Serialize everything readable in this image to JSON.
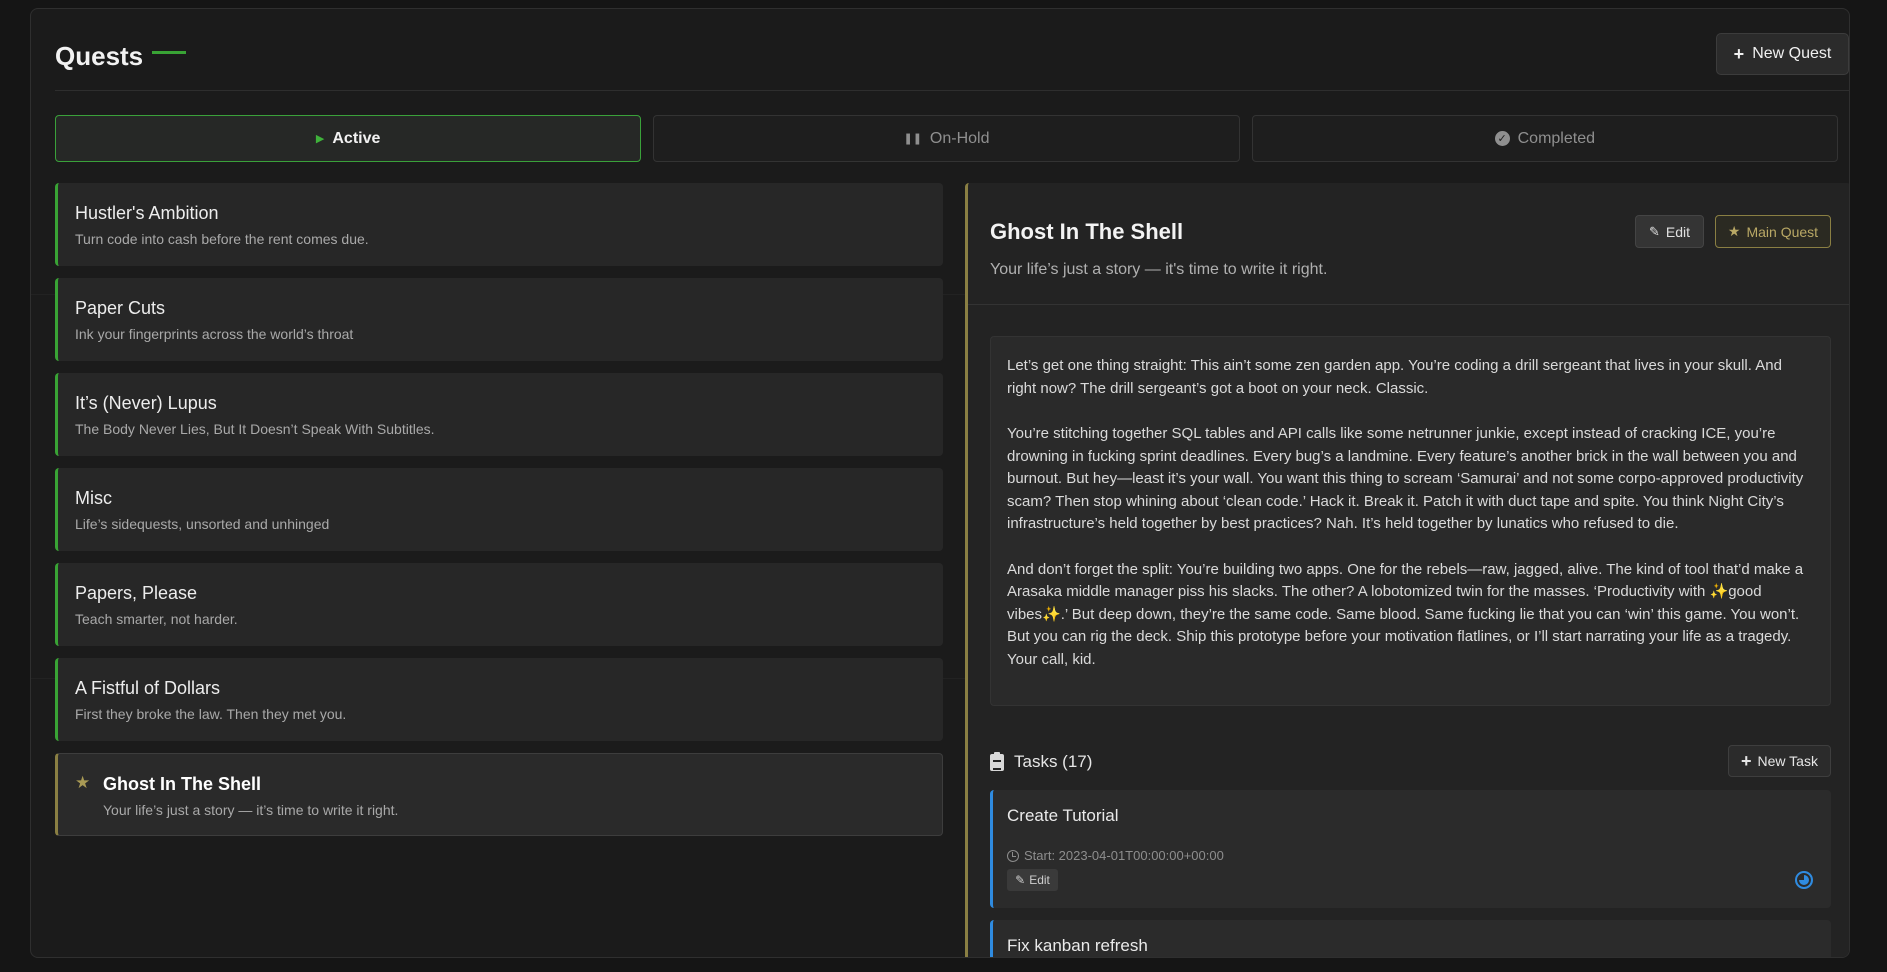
{
  "header": {
    "title": "Quests",
    "new_quest_label": "New Quest"
  },
  "tabs": [
    {
      "label": "Active",
      "icon": "play-icon",
      "active": true
    },
    {
      "label": "On-Hold",
      "icon": "pause-icon",
      "active": false
    },
    {
      "label": "Completed",
      "icon": "check-circle-icon",
      "active": false
    }
  ],
  "quests": [
    {
      "name": "Hustler's Ambition",
      "desc": "Turn code into cash before the rent comes due."
    },
    {
      "name": "Paper Cuts",
      "desc": "Ink your fingerprints across the world’s throat"
    },
    {
      "name": "It’s (Never) Lupus",
      "desc": "The Body Never Lies, But It Doesn’t Speak With Subtitles."
    },
    {
      "name": "Misc",
      "desc": "Life’s sidequests, unsorted and unhinged"
    },
    {
      "name": "Papers, Please",
      "desc": "Teach smarter, not harder."
    },
    {
      "name": "A Fistful of Dollars",
      "desc": "First they broke the law. Then they met you."
    },
    {
      "name": "Ghost In The Shell",
      "desc": "Your life’s just a story — it’s time to write it right.",
      "selected": true,
      "main": true
    }
  ],
  "detail": {
    "title": "Ghost In The Shell",
    "subtitle": "Your life’s just a story — it's time to write it right.",
    "edit_label": "Edit",
    "main_quest_label": "Main Quest",
    "story": [
      "Let’s get one thing straight: This ain’t some zen garden app. You’re coding a drill sergeant that lives in your skull. And right now? The drill sergeant’s got a boot on your neck. Classic.",
      "You’re stitching together SQL tables and API calls like some netrunner junkie, except instead of cracking ICE, you’re drowning in fucking sprint deadlines. Every bug’s a landmine. Every feature’s another brick in the wall between you and burnout. But hey—least it’s your wall. You want this thing to scream ‘Samurai’ and not some corpo-approved productivity scam? Then stop whining about ‘clean code.’ Hack it. Break it. Patch it with duct tape and spite. You think Night City’s infrastructure’s held together by best practices? Nah. It’s held together by lunatics who refused to die.",
      "And don’t forget the split: You’re building two apps. One for the rebels—raw, jagged, alive. The kind of tool that’d make a Arasaka middle manager piss his slacks. The other? A lobotomized twin for the masses. ‘Productivity with ✨good vibes✨.’ But deep down, they’re the same code. Same blood. Same fucking lie that you can ‘win’ this game. You won’t. But you can rig the deck. Ship this prototype before your motivation flatlines, or I’ll start narrating your life as a tragedy. Your call, kid."
    ],
    "tasks_label": "Tasks (17)",
    "new_task_label": "New Task",
    "tasks": [
      {
        "title": "Create Tutorial",
        "start": "Start: 2023-04-01T00:00:00+00:00",
        "edit_label": "Edit"
      },
      {
        "title": "Fix kanban refresh"
      }
    ]
  },
  "colors": {
    "accent_green": "#39a335",
    "accent_gold": "#8a7f43",
    "task_blue": "#2f8be0"
  }
}
